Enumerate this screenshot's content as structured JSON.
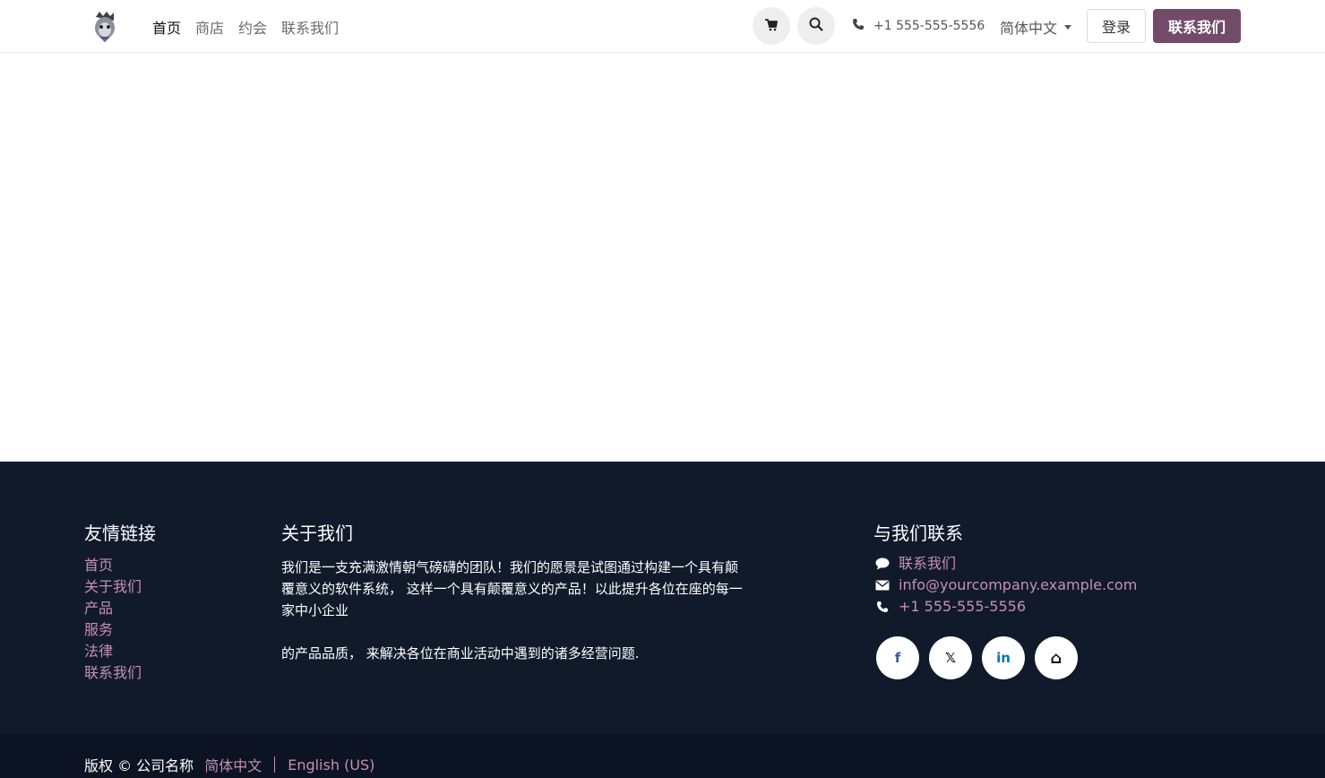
{
  "header": {
    "nav": [
      "首页",
      "商店",
      "约会",
      "联系我们"
    ],
    "phone": "+1 555-555-5556",
    "language": "简体中文",
    "login_label": "登录",
    "contact_label": "联系我们"
  },
  "footer": {
    "links_title": "友情链接",
    "links": [
      "首页",
      "关于我们",
      "产品",
      "服务",
      "法律",
      "联系我们"
    ],
    "about_title": "关于我们",
    "about_p1": "我们是一支充满激情朝气磅礴的团队！我们的愿景是试图通过构建一个具有颠覆意义的软件系统， 这样一个具有颠覆意义的产品！以此提升各位在座的每一家中小企业",
    "about_p2": "的产品品质， 来解决各位在商业活动中遇到的诸多经营问题.",
    "contact_title": "与我们联系",
    "contact_link": "联系我们",
    "email": "info@yourcompany.example.com",
    "phone": "+1 555-555-5556",
    "socials": [
      {
        "icon": "facebook-icon",
        "glyph": "f",
        "color": "#3b5998"
      },
      {
        "icon": "x-twitter-icon",
        "glyph": "𝕏",
        "color": "#111111"
      },
      {
        "icon": "linkedin-icon",
        "glyph": "in",
        "color": "#0077b5"
      },
      {
        "icon": "home-icon",
        "glyph": "⌂",
        "color": "#111111"
      }
    ]
  },
  "copyright": {
    "text": "版权 © 公司名称",
    "lang_zh": "简体中文",
    "lang_en": "English (US)"
  },
  "colors": {
    "accent": "#714b67",
    "footer_bg": "#111a2b",
    "link": "#c58fb4"
  }
}
